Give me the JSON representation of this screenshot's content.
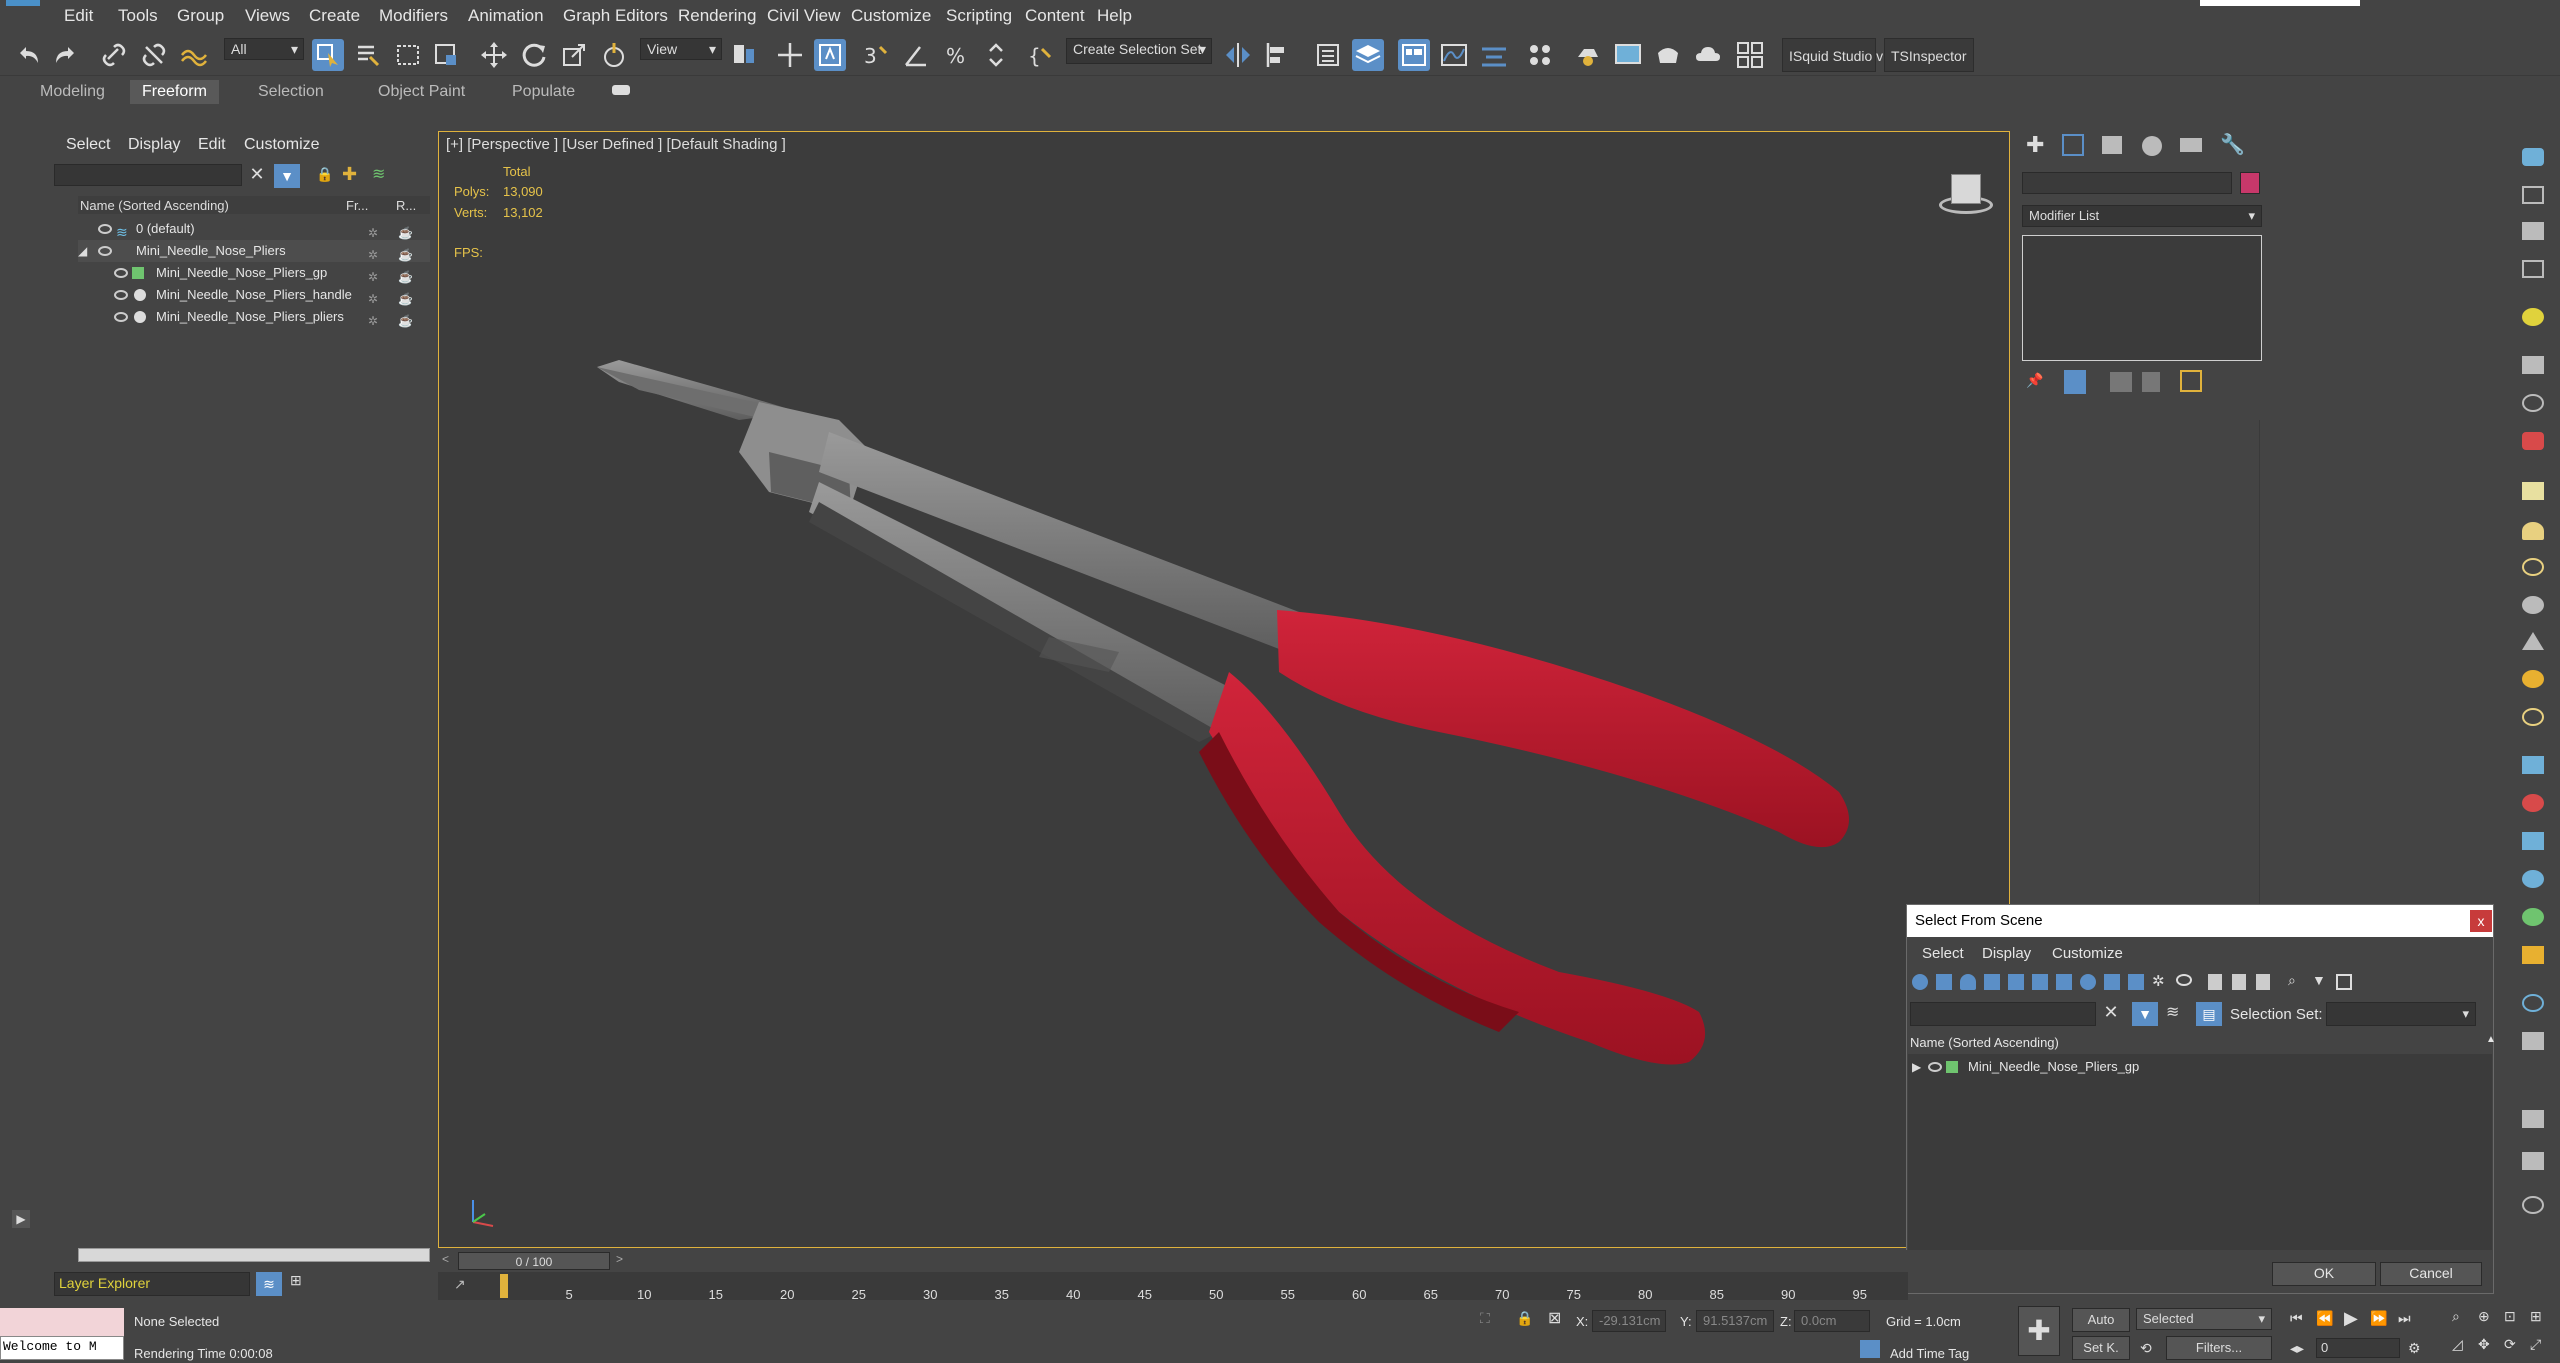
{
  "menubar": {
    "items": [
      "Edit",
      "Tools",
      "Group",
      "Views",
      "Create",
      "Modifiers",
      "Animation",
      "Graph Editors",
      "Rendering",
      "Civil View",
      "Customize",
      "Scripting",
      "Content",
      "Help"
    ]
  },
  "toolbar": {
    "filter_value": "All",
    "view_value": "View",
    "selection_set_placeholder": "Create Selection Set",
    "squid_label": "ISquid Studio v",
    "inspector_label": "TSInspector"
  },
  "ribbon": {
    "tabs": [
      "Modeling",
      "Freeform",
      "Selection",
      "Object Paint",
      "Populate"
    ],
    "active_tab": "Freeform"
  },
  "explorer": {
    "menu": [
      "Select",
      "Display",
      "Edit",
      "Customize"
    ],
    "columns": {
      "name": "Name (Sorted Ascending)",
      "frozen": "Fr...",
      "render": "R..."
    },
    "rows": [
      {
        "label": "0 (default)"
      },
      {
        "label": "Mini_Needle_Nose_Pliers"
      },
      {
        "label": "Mini_Needle_Nose_Pliers_gp"
      },
      {
        "label": "Mini_Needle_Nose_Pliers_handle"
      },
      {
        "label": "Mini_Needle_Nose_Pliers_pliers"
      }
    ],
    "footer_label": "Layer Explorer"
  },
  "viewport": {
    "label": "[+] [Perspective ] [User Defined ] [Default Shading ]",
    "stats": {
      "header": "Total",
      "polys_label": "Polys:",
      "polys_value": "13,090",
      "verts_label": "Verts:",
      "verts_value": "13,102",
      "fps_label": "FPS:"
    }
  },
  "command_panel": {
    "modifier_list": "Modifier List",
    "accent_color": "#c8386a"
  },
  "dialog": {
    "title": "Select From Scene",
    "close": "x",
    "menu": [
      "Select",
      "Display",
      "Customize"
    ],
    "selection_set_label": "Selection Set:",
    "column_header": "Name (Sorted Ascending)",
    "rows": [
      "Mini_Needle_Nose_Pliers_gp"
    ],
    "ok": "OK",
    "cancel": "Cancel"
  },
  "timeline": {
    "frame_display": "0 / 100",
    "ticks": [
      "5",
      "10",
      "15",
      "20",
      "25",
      "30",
      "35",
      "40",
      "45",
      "50",
      "55",
      "60",
      "65",
      "70",
      "75",
      "80",
      "85",
      "90",
      "95"
    ]
  },
  "status": {
    "script_text": "Welcome to M",
    "selection_status": "None Selected",
    "render_time": "Rendering Time  0:00:08",
    "x_label": "X:",
    "x_value": "-29.131cm",
    "y_label": "Y:",
    "y_value": "91.5137cm",
    "z_label": "Z:",
    "z_value": "0.0cm",
    "grid": "Grid = 1.0cm",
    "add_time_tag": "Add Time Tag",
    "auto": "Auto",
    "set_key": "Set K.",
    "selected": "Selected",
    "filters": "Filters...",
    "frame": "0"
  },
  "colors": {
    "viewport_border": "#e0b23c",
    "handle_red": "#c41b2e",
    "highlight_blue": "#5b8fc7"
  }
}
